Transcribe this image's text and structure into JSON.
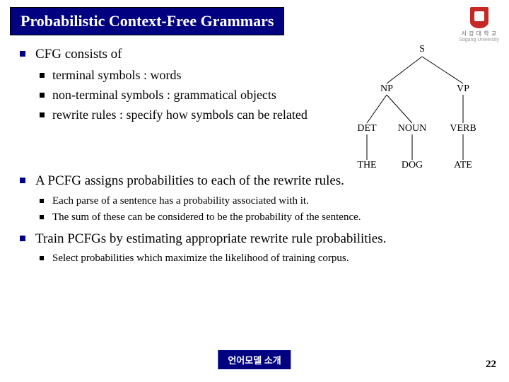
{
  "title": "Probabilistic Context-Free Grammars",
  "logo": {
    "line1": "서 강 대 학 교",
    "line2": "Sogang University"
  },
  "bullets": [
    {
      "text": "CFG consists of",
      "sub": [
        "terminal symbols : words",
        "non-terminal symbols : grammatical objects",
        "rewrite rules : specify how symbols can be related"
      ],
      "subSmall": false,
      "spacer": true
    },
    {
      "text": "A PCFG assigns probabilities to each of the rewrite rules.",
      "sub": [
        "Each parse of a sentence has a probability associated with it.",
        "The sum of these can be considered to be the probability of the sentence."
      ],
      "subSmall": true,
      "spacer": false
    },
    {
      "text": "Train PCFGs by estimating appropriate rewrite rule probabilities.",
      "sub": [
        "Select probabilities which maximize the likelihood of training corpus."
      ],
      "subSmall": true,
      "spacer": false
    }
  ],
  "tree": {
    "S": "S",
    "NP": "NP",
    "VP": "VP",
    "DET": "DET",
    "NOUN": "NOUN",
    "VERB": "VERB",
    "THE": "THE",
    "DOG": "DOG",
    "ATE": "ATE"
  },
  "footer": "언어모델 소개",
  "page": "22"
}
